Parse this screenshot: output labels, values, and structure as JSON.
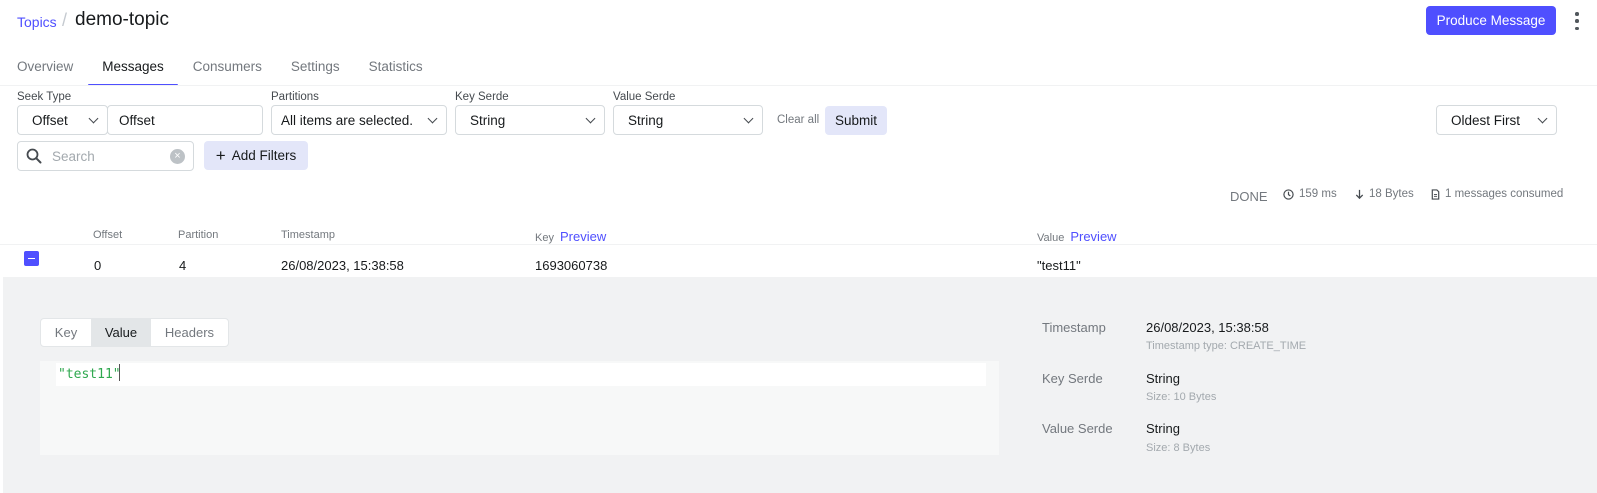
{
  "header": {
    "breadcrumb_link": "Topics",
    "breadcrumb_sep": "/",
    "title": "demo-topic",
    "produce_button": "Produce Message"
  },
  "tabs": [
    {
      "label": "Overview",
      "active": false
    },
    {
      "label": "Messages",
      "active": true
    },
    {
      "label": "Consumers",
      "active": false
    },
    {
      "label": "Settings",
      "active": false
    },
    {
      "label": "Statistics",
      "active": false
    }
  ],
  "filters": {
    "seek_type_label": "Seek Type",
    "seek_type_value": "Offset",
    "offset_value": "Offset",
    "partitions_label": "Partitions",
    "partitions_value": "All items are selected.",
    "key_serde_label": "Key Serde",
    "key_serde_value": "String",
    "value_serde_label": "Value Serde",
    "value_serde_value": "String",
    "clear_all": "Clear all",
    "submit": "Submit",
    "sort_value": "Oldest First",
    "search_placeholder": "Search",
    "add_filters": "Add Filters"
  },
  "meta": {
    "status": "DONE",
    "elapsed": "159 ms",
    "bytes": "18 Bytes",
    "consumed": "1 messages consumed"
  },
  "table": {
    "headers": {
      "offset": "Offset",
      "partition": "Partition",
      "timestamp": "Timestamp",
      "key": "Key",
      "value": "Value",
      "preview": "Preview"
    },
    "rows": [
      {
        "offset": "0",
        "partition": "4",
        "timestamp": "26/08/2023, 15:38:58",
        "key": "1693060738",
        "value": "\"test11\""
      }
    ]
  },
  "detail": {
    "tabs": [
      {
        "label": "Key",
        "active": false
      },
      {
        "label": "Value",
        "active": true
      },
      {
        "label": "Headers",
        "active": false
      }
    ],
    "content": "\"test11\"",
    "info": [
      {
        "label": "Timestamp",
        "value": "26/08/2023, 15:38:58",
        "sub": "Timestamp type: CREATE_TIME"
      },
      {
        "label": "Key Serde",
        "value": "String",
        "sub": "Size: 10 Bytes"
      },
      {
        "label": "Value Serde",
        "value": "String",
        "sub": "Size: 8 Bytes"
      }
    ]
  },
  "colors": {
    "accent": "#4f4fff",
    "json_string": "#2fa84f"
  }
}
